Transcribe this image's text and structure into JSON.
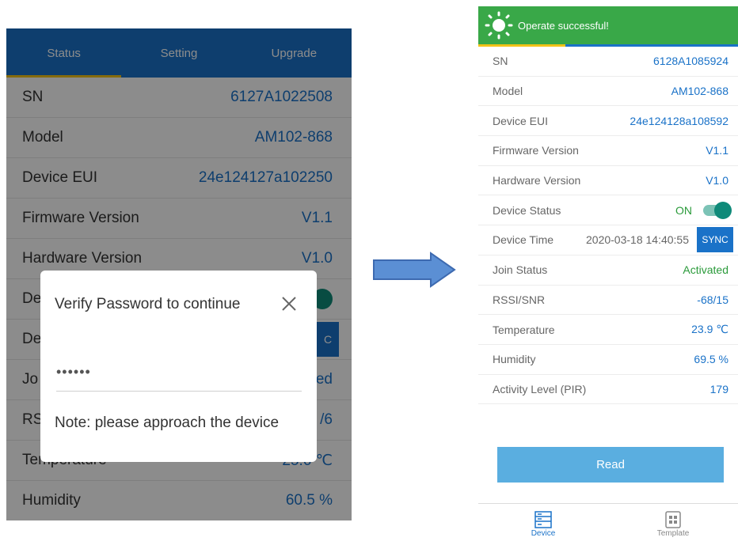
{
  "left": {
    "tabs": [
      {
        "label": "Status"
      },
      {
        "label": "Setting"
      },
      {
        "label": "Upgrade"
      }
    ],
    "rows": [
      {
        "label": "SN",
        "value": "6127A1022508"
      },
      {
        "label": "Model",
        "value": "AM102-868"
      },
      {
        "label": "Device EUI",
        "value": "24e124127a102250"
      },
      {
        "label": "Firmware Version",
        "value": "V1.1"
      },
      {
        "label": "Hardware Version",
        "value": "V1.0"
      },
      {
        "label": "De",
        "value": ""
      },
      {
        "label": "De",
        "value": "C"
      },
      {
        "label": "Jo",
        "value": "ed"
      },
      {
        "label": "RS",
        "value": "/6"
      },
      {
        "label": "Temperature",
        "value": "25.6 ℃"
      },
      {
        "label": "Humidity",
        "value": "60.5 %"
      }
    ],
    "dialog": {
      "title": "Verify Password to continue",
      "password_masked": "••••••",
      "note": "Note: please approach the device"
    }
  },
  "right": {
    "toast": "Operate successful!",
    "rows": [
      {
        "label": "SN",
        "value": "6128A1085924"
      },
      {
        "label": "Model",
        "value": "AM102-868"
      },
      {
        "label": "Device EUI",
        "value": "24e124128a108592"
      },
      {
        "label": "Firmware Version",
        "value": "V1.1"
      },
      {
        "label": "Hardware Version",
        "value": "V1.0"
      },
      {
        "label": "Device Status",
        "value": "ON"
      },
      {
        "label": "Device Time",
        "value": "2020-03-18 14:40:55",
        "button": "SYNC"
      },
      {
        "label": "Join Status",
        "value": "Activated"
      },
      {
        "label": "RSSI/SNR",
        "value": "-68/15"
      },
      {
        "label": "Temperature",
        "value": "23.9 ℃"
      },
      {
        "label": "Humidity",
        "value": "69.5 %"
      },
      {
        "label": "Activity Level (PIR)",
        "value": "179"
      }
    ],
    "read_button": "Read",
    "nav": [
      {
        "label": "Device"
      },
      {
        "label": "Template"
      }
    ]
  },
  "colors": {
    "header_blue": "#1a72c8",
    "toast_green": "#39a848",
    "teal": "#0f8a79",
    "read_button": "#5aaee0"
  }
}
